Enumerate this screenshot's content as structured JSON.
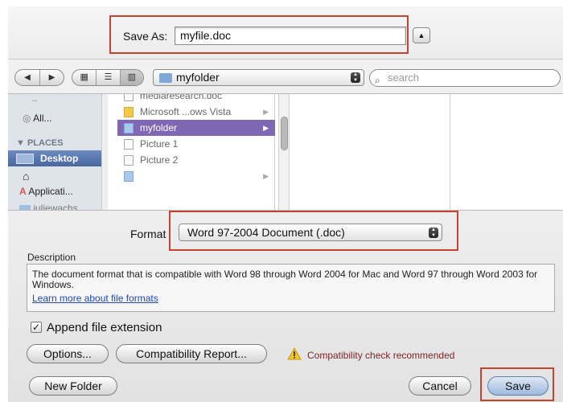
{
  "save_as": {
    "label": "Save As:",
    "value": "myfile.doc"
  },
  "toolbar": {
    "back_glyph": "◀",
    "forward_glyph": "▶",
    "view_icons": [
      "icon-view-icon",
      "list-view-icon",
      "column-view-icon"
    ],
    "view_glyphs": [
      "▦",
      "☰",
      "▥"
    ],
    "location": "myfolder",
    "search_placeholder": "search"
  },
  "sidebar": {
    "items": [
      {
        "label": "All...",
        "icon": "network-icon"
      },
      {
        "label": "PLACES",
        "kind": "header"
      },
      {
        "label": "Desktop",
        "icon": "desktop-icon",
        "selected": true
      },
      {
        "label": "",
        "icon": "home-icon"
      },
      {
        "label": "Applicati...",
        "icon": "applications-icon"
      },
      {
        "label": "juliewachs",
        "icon": "folder-icon"
      }
    ]
  },
  "column1": {
    "rows": [
      {
        "label": "mediaresearch.doc",
        "type": "file"
      },
      {
        "label": "Microsoft ...ows Vista",
        "type": "folder",
        "arrow": true
      },
      {
        "label": "myfolder",
        "type": "folder",
        "arrow": true,
        "selected": true
      },
      {
        "label": "Picture 1",
        "type": "file"
      },
      {
        "label": "Picture 2",
        "type": "file"
      },
      {
        "label": "",
        "type": "folder",
        "arrow": true
      }
    ]
  },
  "format": {
    "label": "Format",
    "selected": "Word 97-2004 Document (.doc)"
  },
  "description": {
    "label": "Description",
    "text": "The document format that is compatible with Word 98 through Word 2004 for Mac and Word 97 through Word 2003 for Windows.",
    "link": "Learn more about file formats"
  },
  "append_extension": {
    "label": "Append file extension",
    "checked": true
  },
  "buttons": {
    "options": "Options...",
    "compat_report": "Compatibility Report...",
    "new_folder": "New Folder",
    "cancel": "Cancel",
    "save": "Save"
  },
  "warning_text": "Compatibility check recommended",
  "colors": {
    "highlight": "#c8432f",
    "selection": "#7e68b4",
    "link": "#2147b5"
  }
}
